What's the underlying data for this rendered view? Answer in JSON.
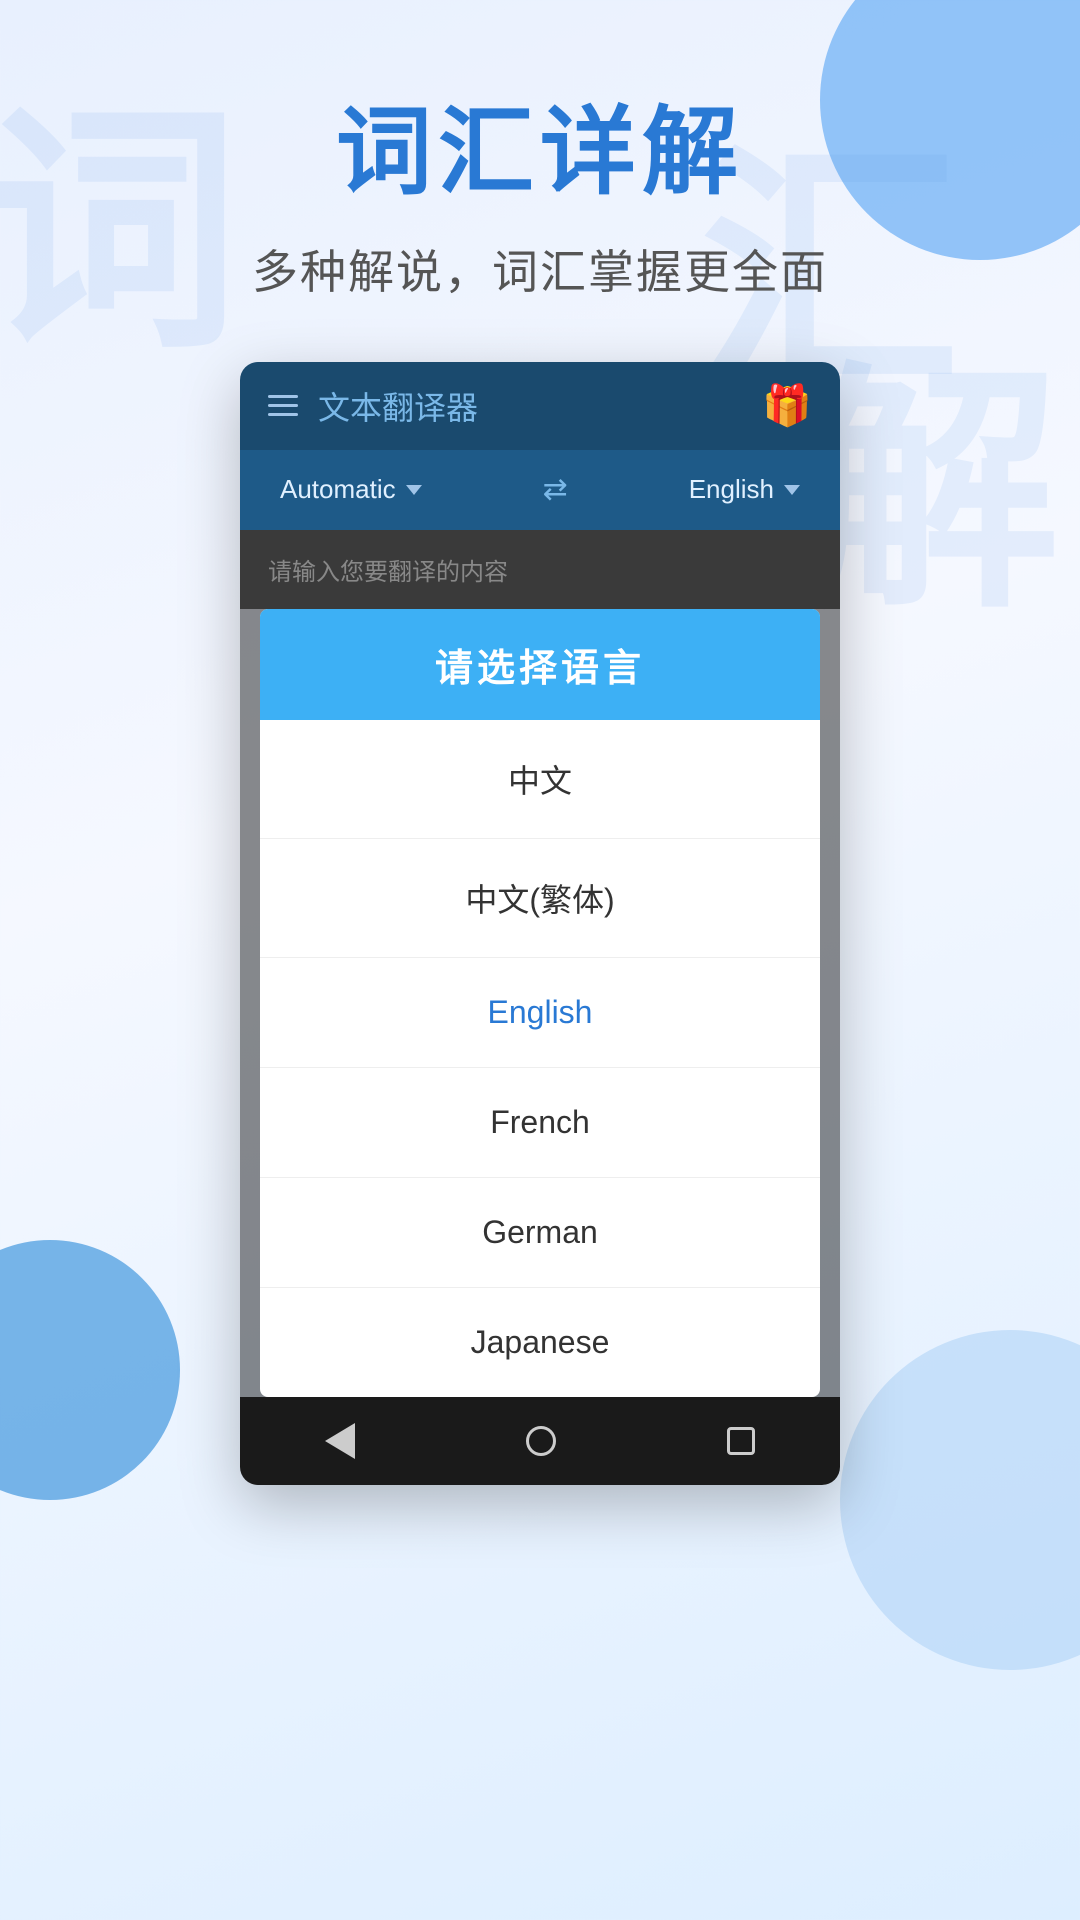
{
  "background": {
    "watermarks": [
      "词",
      "汇",
      "解"
    ]
  },
  "header": {
    "main_title": "词汇详解",
    "sub_title": "多种解说，词汇掌握更全面"
  },
  "app": {
    "topbar": {
      "title": "文本翻译器",
      "gift_icon": "🎁"
    },
    "lang_bar": {
      "source_lang": "Automatic",
      "target_lang": "English",
      "swap_symbol": "⇄"
    },
    "input": {
      "placeholder": "请输入您要翻译的内容"
    },
    "dialog": {
      "title": "请选择语言",
      "languages": [
        {
          "label": "中文",
          "selected": false
        },
        {
          "label": "中文(繁体)",
          "selected": false
        },
        {
          "label": "English",
          "selected": true
        },
        {
          "label": "French",
          "selected": false
        },
        {
          "label": "German",
          "selected": false
        },
        {
          "label": "Japanese",
          "selected": false
        }
      ]
    },
    "bottom_nav": {
      "back_label": "back",
      "home_label": "home",
      "recent_label": "recent"
    }
  }
}
